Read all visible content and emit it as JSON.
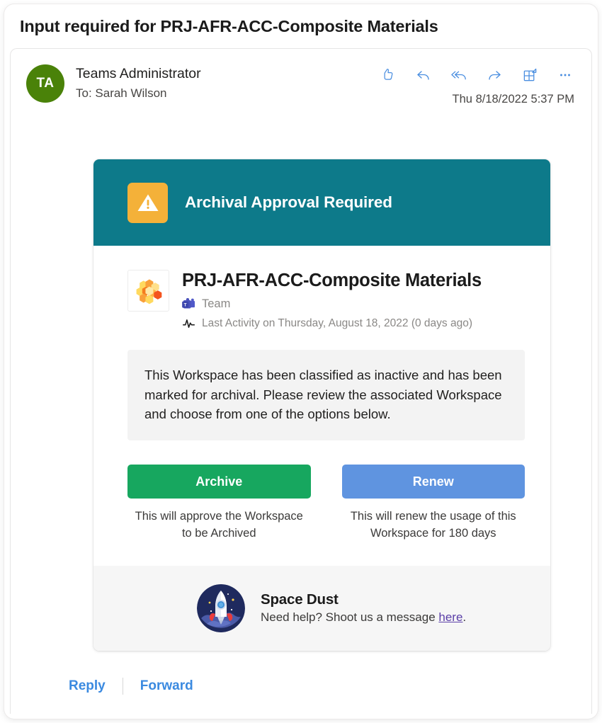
{
  "colors": {
    "banner_teal": "#0d7a8a",
    "warn_orange": "#f4b139",
    "archive_green": "#17a75f",
    "renew_blue": "#5f94e0",
    "avatar_green": "#4a8209",
    "link_blue": "#3b8ae0",
    "help_link_purple": "#5b3fa8"
  },
  "subject": {
    "title": "Input required for PRJ-AFR-ACC-Composite Materials"
  },
  "sender": {
    "avatar_initials": "TA",
    "name": "Teams Administrator",
    "recipient": "To:  Sarah Wilson",
    "timestamp": "Thu 8/18/2022 5:37 PM"
  },
  "header_actions": [
    {
      "name": "thumbs-up-icon",
      "label": "Like"
    },
    {
      "name": "reply-icon",
      "label": "Reply"
    },
    {
      "name": "reply-all-icon",
      "label": "Reply all"
    },
    {
      "name": "forward-icon",
      "label": "Forward"
    },
    {
      "name": "apps-icon",
      "label": "Apps"
    },
    {
      "name": "more-options-icon",
      "label": "More actions"
    }
  ],
  "notification": {
    "banner_title": "Archival Approval Required",
    "banner_icon": "warning-triangle-icon",
    "workspace": {
      "icon": "honeycomb-workspace-icon",
      "title": "PRJ-AFR-ACC-Composite Materials",
      "type_icon": "microsoft-teams-icon",
      "type_label": "Team",
      "activity_icon": "activity-pulse-icon",
      "activity_label": "Last Activity on Thursday, August 18, 2022 (0 days ago)"
    },
    "description": "This Workspace has been classified as inactive and has been marked for archival. Please review the associated Workspace and choose from one of the options below.",
    "actions": [
      {
        "label": "Archive",
        "description": "This will approve the Workspace to be Archived",
        "color": "#17a75f"
      },
      {
        "label": "Renew",
        "description": "This will renew the usage of this Workspace for 180 days",
        "color": "#5f94e0"
      }
    ],
    "help": {
      "icon": "rocket-icon",
      "title": "Space Dust",
      "message_prefix": "Need help? Shoot us a message ",
      "link_text": "here",
      "message_suffix": "."
    }
  },
  "footer": {
    "reply_label": "Reply",
    "forward_label": "Forward"
  }
}
